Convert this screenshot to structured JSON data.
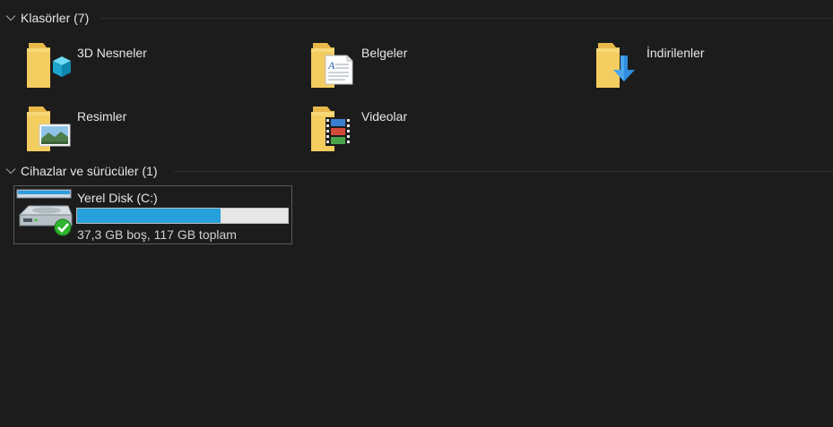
{
  "groups": {
    "folders": {
      "title": "Klasörler (7)",
      "items": [
        {
          "label": "3D Nesneler",
          "icon": "folder-3d-objects-icon"
        },
        {
          "label": "Belgeler",
          "icon": "folder-documents-icon"
        },
        {
          "label": "İndirilenler",
          "icon": "folder-downloads-icon"
        },
        {
          "label": "Resimler",
          "icon": "folder-pictures-icon"
        },
        {
          "label": "Videolar",
          "icon": "folder-videos-icon"
        }
      ]
    },
    "devices": {
      "title": "Cihazlar ve sürücüler (1)",
      "drive": {
        "name": "Yerel Disk (C:)",
        "info": "37,3 GB boş, 117 GB toplam",
        "used_fraction": 0.681,
        "icon": "hard-drive-icon"
      }
    }
  },
  "colors": {
    "background": "#1c1c1c",
    "text": "#e6e6e6",
    "usage_bar": "#26a0da"
  }
}
